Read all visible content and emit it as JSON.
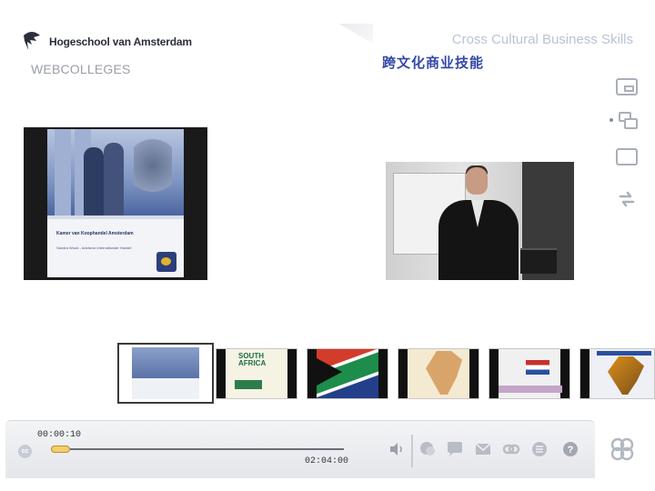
{
  "header": {
    "logo_text": "Hogeschool van Amsterdam",
    "subtitle": "WEBCOLLEGES",
    "title_en": "Cross Cultural Business Skills",
    "title_zh": "跨文化商业技能"
  },
  "slide": {
    "title": "Kamer van Koophandel Amsterdam",
    "presenter": "Sandra Wood - Adviseur Internationale Handel"
  },
  "thumbnails": [
    {
      "name": "slide-1",
      "active": true
    },
    {
      "name": "slide-2",
      "active": false,
      "text": "SOUTH AFRICA"
    },
    {
      "name": "slide-3",
      "active": false
    },
    {
      "name": "slide-4",
      "active": false
    },
    {
      "name": "slide-5",
      "active": false
    },
    {
      "name": "slide-6",
      "active": false
    }
  ],
  "player": {
    "cc_label": "cc",
    "current_time": "00:00:10",
    "total_time": "02:04:00",
    "progress": 0.0013
  },
  "icons": [
    "layout-pip-icon",
    "layout-split-icon",
    "layout-single-icon",
    "swap-icon",
    "volume-icon",
    "chat-icon",
    "comment-icon",
    "mail-icon",
    "link-icon",
    "list-icon",
    "help-icon",
    "brand-icon"
  ],
  "colors": {
    "accent_blue": "#3348a8",
    "title_grey_blue": "#b9c4d4",
    "progress_knob": "#f2cf6b"
  }
}
